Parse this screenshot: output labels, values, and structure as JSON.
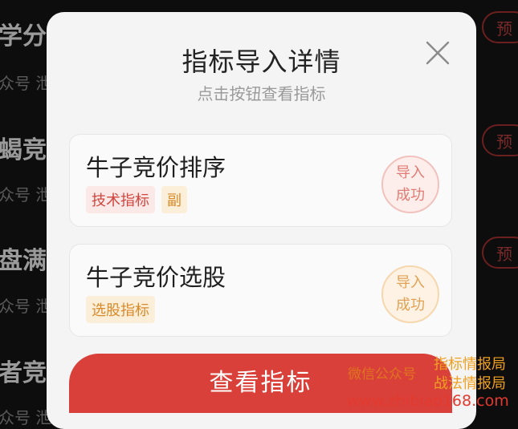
{
  "background": {
    "rows": [
      {
        "title": "学分",
        "sub": "众号 泄",
        "badge": "预"
      },
      {
        "title": "蝎竞",
        "sub": "众号 泄",
        "badge": "预"
      },
      {
        "title": "盘满",
        "sub": "众号 泄",
        "badge": "预"
      },
      {
        "title": "者竞",
        "sub": "众号 泄",
        "badge": ""
      }
    ]
  },
  "modal": {
    "title": "指标导入详情",
    "subtitle": "点击按钮查看指标",
    "close_icon": "close-icon",
    "cards": [
      {
        "name": "牛子竞价排序",
        "tags": [
          "技术指标",
          "副"
        ],
        "status_line1": "导入",
        "status_line2": "成功",
        "status_color": "#e27b73"
      },
      {
        "name": "牛子竞价选股",
        "tags": [
          "选股指标"
        ],
        "status_line1": "导入",
        "status_line2": "成功",
        "status_color": "#e0a255"
      }
    ],
    "button_label": "查看指标",
    "accent": "#d9403a"
  },
  "watermark": {
    "line_left": "微信公众号",
    "line_top": "指标情报局",
    "line_mid": "战法情报局",
    "url": "www.zhibiao168.com"
  }
}
